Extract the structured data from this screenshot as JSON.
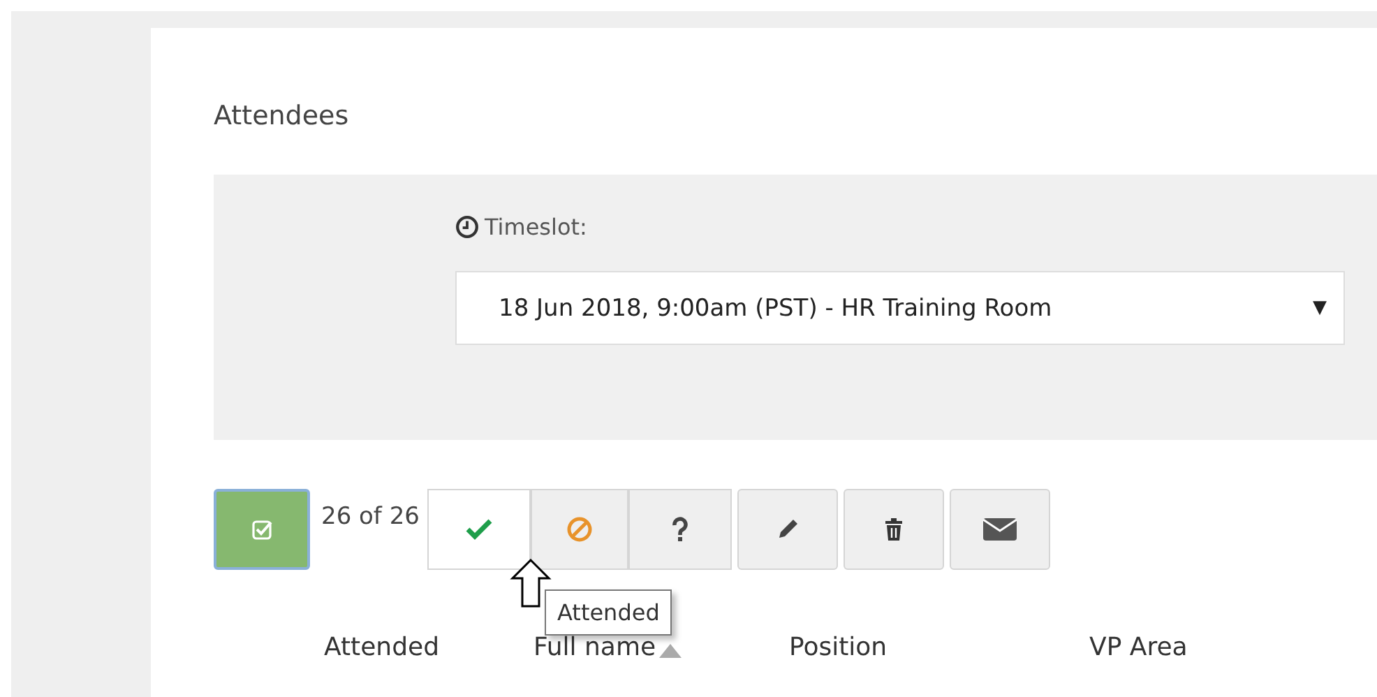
{
  "section": {
    "title": "Attendees"
  },
  "timeslot": {
    "label": "Timeslot:",
    "value": "18 Jun 2018, 9:00am (PST) - HR Training Room",
    "caret": "▼"
  },
  "toolbar": {
    "select_all": {
      "checked": true
    },
    "count": "26 of 26",
    "filters": [
      {
        "kind": "check",
        "selected": true
      },
      {
        "kind": "ban",
        "selected": false
      },
      {
        "kind": "question",
        "selected": false
      }
    ],
    "actions": [
      {
        "kind": "pencil"
      },
      {
        "kind": "trash"
      },
      {
        "kind": "envelope"
      }
    ]
  },
  "tooltip": "Attended",
  "table": {
    "columns": [
      {
        "label": "Attended",
        "sorted": false
      },
      {
        "label": "Full name",
        "sorted": true
      },
      {
        "label": "Position",
        "sorted": false
      },
      {
        "label": "VP Area",
        "sorted": false
      }
    ]
  }
}
